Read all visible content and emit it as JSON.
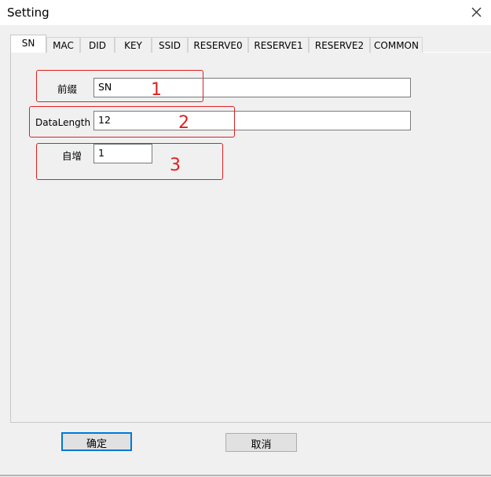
{
  "window": {
    "title": "Setting"
  },
  "tabs": [
    "SN",
    "MAC",
    "DID",
    "KEY",
    "SSID",
    "RESERVE0",
    "RESERVE1",
    "RESERVE2",
    "COMMON"
  ],
  "form": {
    "prefix": {
      "label": "前缀",
      "value": "SN"
    },
    "data_length": {
      "label": "DataLength",
      "value": "12"
    },
    "auto_increment": {
      "label": "自增",
      "value": "1"
    }
  },
  "annotations": [
    "1",
    "2",
    "3"
  ],
  "buttons": {
    "ok": "确定",
    "cancel": "取消"
  },
  "colors": {
    "annotation": "#e02020",
    "default_button_border": "#0078d7"
  }
}
